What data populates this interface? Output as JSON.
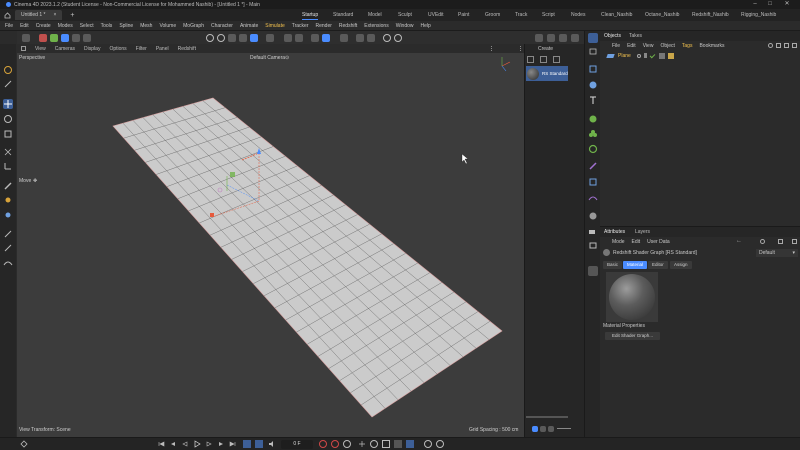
{
  "window": {
    "title": "Cinema 4D 2023.1.2 (Student License - Non-Commercial License for Mohammed Nashib) - [Untitled 1 *] - Main",
    "controls": [
      "–",
      "□",
      "✕"
    ]
  },
  "doc_tab": {
    "label": "Untitled 1 *",
    "close": "×",
    "add": "+"
  },
  "layouts": [
    "Startup",
    "Standard",
    "Model",
    "Sculpt",
    "UVEdit",
    "Paint",
    "Groom",
    "Track",
    "Script",
    "Nodes",
    "Clean_Nashib",
    "Octane_Nashib",
    "Redshift_Nashib",
    "Rigging_Nashib"
  ],
  "active_layout": "Startup",
  "menu": [
    "File",
    "Edit",
    "Create",
    "Modes",
    "Select",
    "Tools",
    "Spline",
    "Mesh",
    "Volume",
    "MoGraph",
    "Character",
    "Animate",
    "Simulate",
    "Tracker",
    "Render",
    "Redshift",
    "Extensions",
    "Window",
    "Help"
  ],
  "viewport_menu": [
    "View",
    "Cameras",
    "Display",
    "Options",
    "Filter",
    "Panel",
    "Redshift"
  ],
  "viewport": {
    "projection": "Perspective",
    "camera": "Default Camera",
    "camera_icon": "⊙",
    "move_label": "Move",
    "move_icon": "✥",
    "transform_scene": "View Transform: Scene",
    "grid_spacing": "Grid Spacing : 500 cm"
  },
  "frame_field": "0 F",
  "rs_panel": {
    "create_label": "Create",
    "material_name": "RS Standard"
  },
  "objects_panel": {
    "tabs": [
      "Objects",
      "Takes"
    ],
    "menu": [
      "File",
      "Edit",
      "View",
      "Object",
      "Tags",
      "Bookmarks"
    ],
    "object_name": "Plane"
  },
  "attributes_panel": {
    "tabs": [
      "Attributes",
      "Layers"
    ],
    "menu": [
      "Mode",
      "Edit",
      "User Data"
    ],
    "header": "Redshift Shader Graph [RS Standard]",
    "preset": "Default",
    "subtabs": [
      "Basic",
      "Material",
      "Editor",
      "Assign"
    ],
    "active_subtab": "Material",
    "section": "Material Properties",
    "edit_button": "Edit Shader Graph..."
  },
  "colors": {
    "accent": "#4a8cff",
    "highlight_menu": "#f2c14e",
    "plane": "#cbcbcb",
    "viewport_bg": "#3c3c3c"
  }
}
